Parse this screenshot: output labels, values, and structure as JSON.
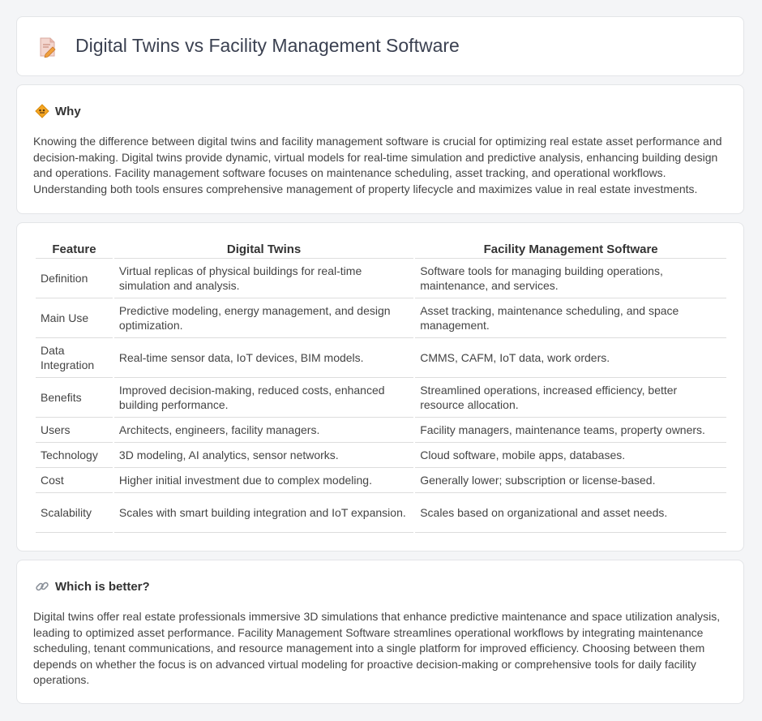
{
  "header": {
    "title": "Digital Twins vs Facility Management Software",
    "icon": "document-pen-icon"
  },
  "why": {
    "title": "Why",
    "icon": "warning-sign-icon",
    "body": "Knowing the difference between digital twins and facility management software is crucial for optimizing real estate asset performance and decision-making. Digital twins provide dynamic, virtual models for real-time simulation and predictive analysis, enhancing building design and operations. Facility management software focuses on maintenance scheduling, asset tracking, and operational workflows. Understanding both tools ensures comprehensive management of property lifecycle and maximizes value in real estate investments."
  },
  "table": {
    "headers": [
      "Feature",
      "Digital Twins",
      "Facility Management Software"
    ],
    "rows": [
      [
        "Definition",
        "Virtual replicas of physical buildings for real-time simulation and analysis.",
        "Software tools for managing building operations, maintenance, and services."
      ],
      [
        "Main Use",
        "Predictive modeling, energy management, and design optimization.",
        "Asset tracking, maintenance scheduling, and space management."
      ],
      [
        "Data Integration",
        "Real-time sensor data, IoT devices, BIM models.",
        "CMMS, CAFM, IoT data, work orders."
      ],
      [
        "Benefits",
        "Improved decision-making, reduced costs, enhanced building performance.",
        "Streamlined operations, increased efficiency, better resource allocation."
      ],
      [
        "Users",
        "Architects, engineers, facility managers.",
        "Facility managers, maintenance teams, property owners."
      ],
      [
        "Technology",
        "3D modeling, AI analytics, sensor networks.",
        "Cloud software, mobile apps, databases."
      ],
      [
        "Cost",
        "Higher initial investment due to complex modeling.",
        "Generally lower; subscription or license-based."
      ],
      [
        "Scalability",
        "Scales with smart building integration and IoT expansion.",
        "Scales based on organizational and asset needs."
      ]
    ]
  },
  "better": {
    "title": "Which is better?",
    "icon": "link-icon",
    "body": "Digital twins offer real estate professionals immersive 3D simulations that enhance predictive maintenance and space utilization analysis, leading to optimized asset performance. Facility Management Software streamlines operational workflows by integrating maintenance scheduling, tenant communications, and resource management into a single platform for improved efficiency. Choosing between them depends on whether the focus is on advanced virtual modeling for proactive decision-making or comprehensive tools for daily facility operations."
  }
}
